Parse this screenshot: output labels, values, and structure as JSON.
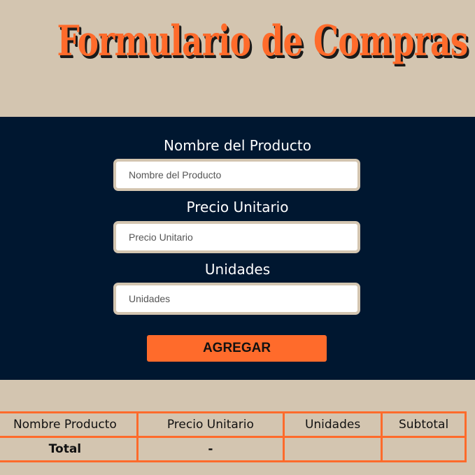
{
  "header": {
    "title": "Formulario de Compras"
  },
  "form": {
    "fields": [
      {
        "label": "Nombre del Producto",
        "placeholder": "Nombre del Producto",
        "value": ""
      },
      {
        "label": "Precio Unitario",
        "placeholder": "Precio Unitario",
        "value": ""
      },
      {
        "label": "Unidades",
        "placeholder": "Unidades",
        "value": ""
      }
    ],
    "submit_label": "AGREGAR"
  },
  "table": {
    "columns": [
      "Nombre Producto",
      "Precio Unitario",
      "Unidades",
      "Subtotal"
    ],
    "total_row": {
      "label": "Total",
      "precio": "-",
      "unidades": "",
      "subtotal": ""
    }
  },
  "colors": {
    "accent": "#ff6b2b",
    "background": "#d3c5b0",
    "panel": "#001730"
  }
}
